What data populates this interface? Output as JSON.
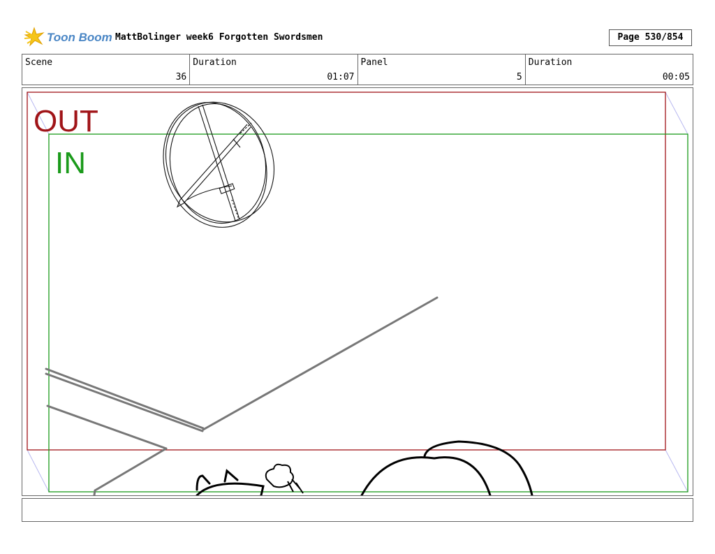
{
  "header": {
    "logo_text": "Toon Boom",
    "title": "MattBolinger week6 Forgotten Swordsmen",
    "page": "Page 530/854"
  },
  "info": {
    "scene_label": "Scene",
    "scene_value": "36",
    "scene_duration_label": "Duration",
    "scene_duration_value": "01:07",
    "panel_label": "Panel",
    "panel_value": "5",
    "panel_duration_label": "Duration",
    "panel_duration_value": "00:05"
  },
  "frame": {
    "out_label": "OUT",
    "in_label": "IN",
    "out_color": "#a01418",
    "in_color": "#1a9a1a"
  },
  "notes": {
    "text": ""
  }
}
